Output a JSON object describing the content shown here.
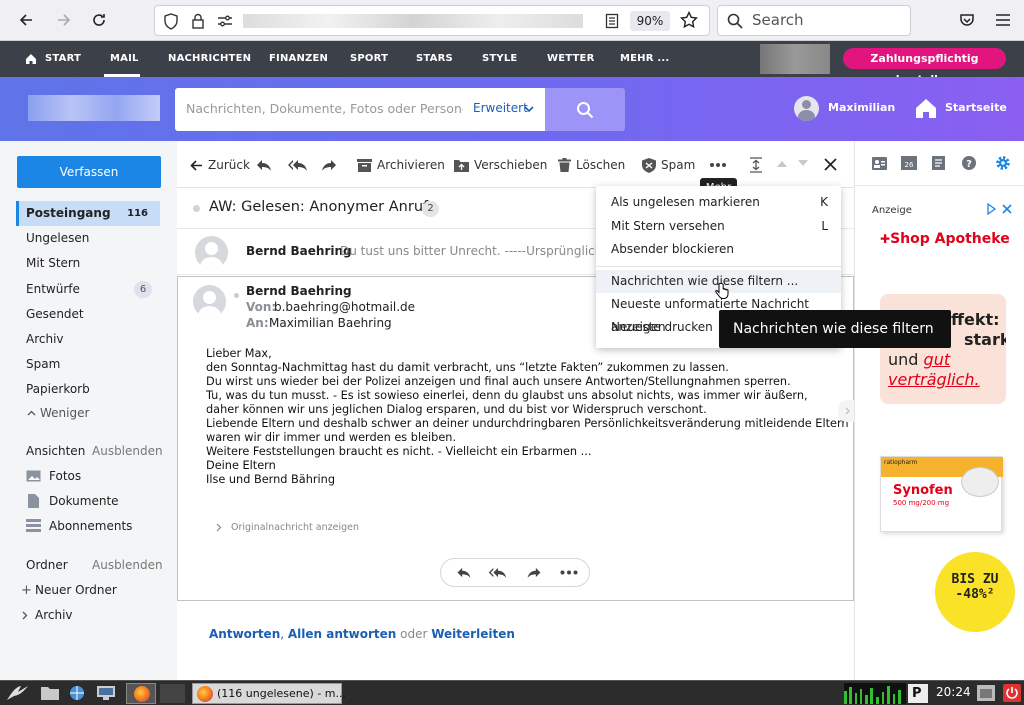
{
  "browser": {
    "zoom": "90%",
    "search_placeholder": "Search"
  },
  "topnav": {
    "items": [
      "START",
      "MAIL",
      "NACHRICHTEN",
      "FINANZEN",
      "SPORT",
      "STARS",
      "STYLE",
      "WETTER",
      "MEHR ..."
    ],
    "pay_button": "Zahlungspflichtig bestellen"
  },
  "header": {
    "search_placeholder": "Nachrichten, Dokumente, Fotos oder Personen",
    "advanced": "Erweitert",
    "user": "Maximilian",
    "home": "Startseite"
  },
  "sidebar": {
    "compose": "Verfassen",
    "folders": [
      {
        "label": "Posteingang",
        "count": "116"
      },
      {
        "label": "Ungelesen"
      },
      {
        "label": "Mit Stern"
      },
      {
        "label": "Entwürfe",
        "count": "6"
      },
      {
        "label": "Gesendet"
      },
      {
        "label": "Archiv"
      },
      {
        "label": "Spam"
      },
      {
        "label": "Papierkorb"
      }
    ],
    "less": "Weniger",
    "views_title": "Ansichten",
    "views_hide": "Ausblenden",
    "views": [
      "Fotos",
      "Dokumente",
      "Abonnements"
    ],
    "folders_title": "Ordner",
    "folders_hide": "Ausblenden",
    "new_folder": "Neuer Ordner",
    "archive": "Archiv"
  },
  "toolbar": {
    "back": "Zurück",
    "archive": "Archivieren",
    "move": "Verschieben",
    "delete": "Löschen",
    "spam": "Spam",
    "more_tooltip": "Mehr"
  },
  "thread": {
    "subject": "AW: Gelesen: Anonymer Anruf",
    "count": "2",
    "collapsed_sender": "Bernd Baehring",
    "collapsed_preview": "Du tust uns bitter Unrecht. -----Ursprüngliche Nachr"
  },
  "message": {
    "sender": "Bernd Baehring",
    "from_label": "Von:",
    "from": "b.baehring@hotmail.de",
    "to_label": "An:",
    "to": "Maximilian Baehring",
    "body": [
      "Lieber Max,",
      "den Sonntag-Nachmittag hast du damit verbracht, uns “letzte Fakten” zukommen zu lassen.",
      "Du wirst uns wieder bei der Polizei anzeigen und final auch unsere Antworten/Stellungnahmen sperren.",
      "Tu, was du tun musst. - Es ist sowieso einerlei, denn du glaubst uns absolut nichts, was immer wir äußern,",
      "daher können wir uns jeglichen Dialog ersparen, und du bist vor Widerspruch verschont.",
      "Liebende Eltern und deshalb schwer an deiner undurchdringbaren Persönlichkeitsveränderung mitleidende Eltern",
      "waren wir dir immer und werden es bleiben.",
      "Weitere Feststellungen braucht es nicht. - Vielleicht ein Erbarmen ...",
      "Deine Eltern",
      "Ilse und Bernd Bähring"
    ],
    "show_original": "Originalnachricht anzeigen",
    "reply": "Antworten",
    "reply_all": "Allen antworten",
    "or": "oder",
    "forward": "Weiterleiten"
  },
  "dropdown": {
    "items": [
      {
        "label": "Als ungelesen markieren",
        "key": "K"
      },
      {
        "label": "Mit Stern versehen",
        "key": "L"
      },
      {
        "label": "Absender blockieren",
        "key": ""
      },
      {
        "label": "Nachrichten wie diese filtern ...",
        "key": ""
      },
      {
        "label": "Neueste unformatierte Nachricht anzeigen",
        "key": ""
      },
      {
        "label": "Neueste drucken",
        "key": ""
      }
    ],
    "tooltip": "Nachrichten wie diese filtern ..."
  },
  "ad": {
    "label": "Anzeige",
    "brand": "Shop Apotheke",
    "text1": "ffekt:",
    "text2": "stark",
    "text3a": "und",
    "text3b": "gut",
    "text4": "verträglich.",
    "product": "Synofen",
    "product_sub": "500 mg/200 mg",
    "maker": "ratiopharm",
    "discount1": "BIS ZU",
    "discount2": "-48%²"
  },
  "taskbar": {
    "window_title": "(116 ungelesene) - m...",
    "clock": "20:24"
  },
  "colors": {
    "accent": "#1c86e6",
    "nav": "#3c4048",
    "pay": "#e2157f",
    "link": "#1a5fb4"
  }
}
